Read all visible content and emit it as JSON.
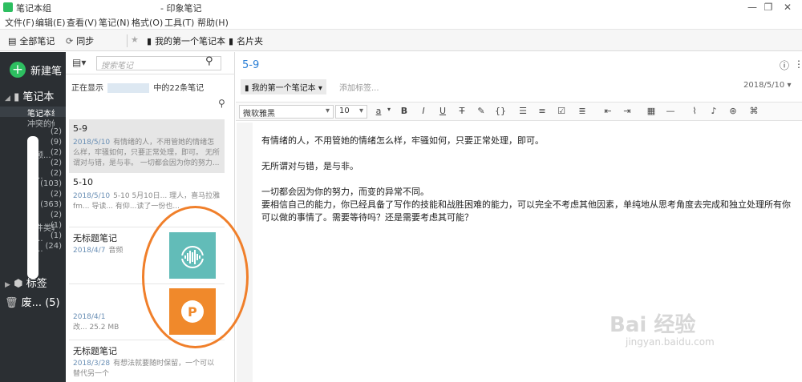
{
  "window": {
    "title": "笔记本组",
    "title_suffix": "- 印象笔记"
  },
  "menu": [
    "文件(F)",
    "编辑(E)",
    "查看(V)",
    "笔记(N)",
    "格式(O)",
    "工具(T)",
    "帮助(H)"
  ],
  "toolbar": {
    "all_notes": "全部笔记",
    "sync": "同步",
    "notebook": "我的第一个笔记本",
    "cards": "名片夹"
  },
  "sidebar": {
    "new_note": "新建笔",
    "notebooks_header": "笔记本",
    "notebooks": [
      {
        "label": "笔记本组",
        "count": ""
      },
      {
        "label": "冲突的修...",
        "count": ""
      },
      {
        "label": "",
        "count": "(2)"
      },
      {
        "label": "",
        "count": "(9)"
      },
      {
        "label": "视频...",
        "count": "(2)"
      },
      {
        "label": "",
        "count": "(2)"
      },
      {
        "label": "励...",
        "count": "(2)"
      },
      {
        "label": "",
        "count": "(103)"
      },
      {
        "label": "",
        "count": "(2)"
      },
      {
        "label": "",
        "count": "(363)"
      },
      {
        "label": "",
        "count": "(2)"
      },
      {
        "label": "文件类辅...",
        "count": "(1)"
      },
      {
        "label": "问...",
        "count": "(1)"
      },
      {
        "label": "整...",
        "count": "(24)"
      }
    ],
    "tags_header": "标签",
    "trash_header": "废...",
    "trash_count": "(5)"
  },
  "notelist": {
    "search_placeholder": "搜索笔记",
    "showing_prefix": "正在显示",
    "showing_suffix": "中的22条笔记",
    "notes": [
      {
        "title": "5-9",
        "date": "2018/5/10",
        "snippet": "有情绪的人，不用管她的情绪怎么样，牢骚如何，只要正常处理，即可。 无所谓对与错，是与非。 一切都会因为你的努力..."
      },
      {
        "title": "5-10",
        "date": "2018/5/10",
        "snippet": "5-10 5月10日... 理人，喜马拉雅fm... 导读... 有仰...读了一份也..."
      },
      {
        "title": "无标题笔记",
        "date": "2018/4/7",
        "snippet": "音频"
      },
      {
        "title": "",
        "date": "2018/4/1",
        "snippet": "改... 25.2 MB"
      },
      {
        "title": "无标题笔记",
        "date": "2018/3/28",
        "snippet": "有想法就要随时保留，一个可以替代另一个"
      }
    ]
  },
  "editor": {
    "title": "5-9",
    "notebook_tag": "我的第一个笔记本",
    "add_tag": "添加标签...",
    "date": "2018/5/10",
    "font": "微软雅黑",
    "font_size": "10",
    "content": [
      "有情绪的人，不用管她的情绪怎么样，牢骚如何，只要正常处理，即可。",
      "",
      "无所谓对与错，是与非。",
      "",
      "一切都会因为你的努力，而变的异常不同。",
      "要相信自己的能力，你已经具备了写作的技能和战胜困难的能力，可以完全不考虑其他因素，单纯地从思考角度去完成和独立处理所有你可以做的事情了。需要等待吗？还是需要考虑其可能？"
    ]
  },
  "watermark": {
    "brand": "Bai 经验",
    "url": "jingyan.baidu.com"
  },
  "colors": {
    "accent": "#2dbe60",
    "sidebar": "#2b2f33",
    "link": "#2b7fd6",
    "ring": "#f07f2a",
    "thumb1": "#62bcb8",
    "thumb2": "#f0892b"
  }
}
